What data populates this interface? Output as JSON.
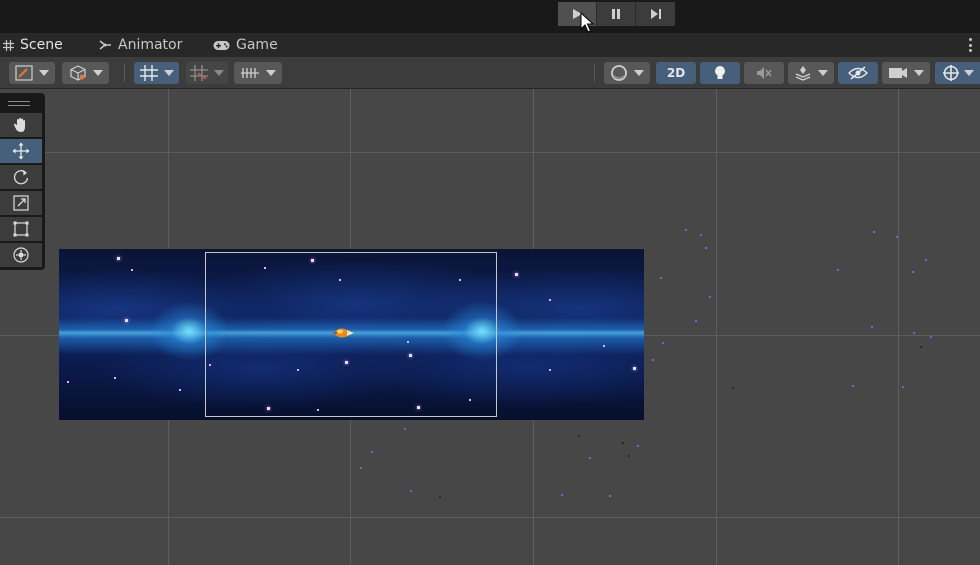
{
  "playbar": {
    "buttons": [
      {
        "name": "play-button",
        "icon": "play-icon",
        "active": true
      },
      {
        "name": "pause-button",
        "icon": "pause-icon",
        "active": false
      },
      {
        "name": "step-button",
        "icon": "step-forward-icon",
        "active": false
      }
    ]
  },
  "tabs": [
    {
      "label": "Scene",
      "icon": "grid-icon",
      "active": true
    },
    {
      "label": "Animator",
      "icon": "animator-icon",
      "active": false
    },
    {
      "label": "Game",
      "icon": "gamepad-icon",
      "active": false
    }
  ],
  "toolbar": {
    "mode_2d_label": "2D",
    "accent": "#46607c"
  },
  "tools": [
    {
      "name": "hand-tool",
      "icon": "hand-icon",
      "active": false
    },
    {
      "name": "move-tool",
      "icon": "move-icon",
      "active": true
    },
    {
      "name": "rotate-tool",
      "icon": "rotate-icon",
      "active": false
    },
    {
      "name": "scale-tool",
      "icon": "scale-icon",
      "active": false
    },
    {
      "name": "rect-tool",
      "icon": "rect-transform-icon",
      "active": false
    },
    {
      "name": "transform-tool",
      "icon": "transform-icon",
      "active": false
    }
  ]
}
